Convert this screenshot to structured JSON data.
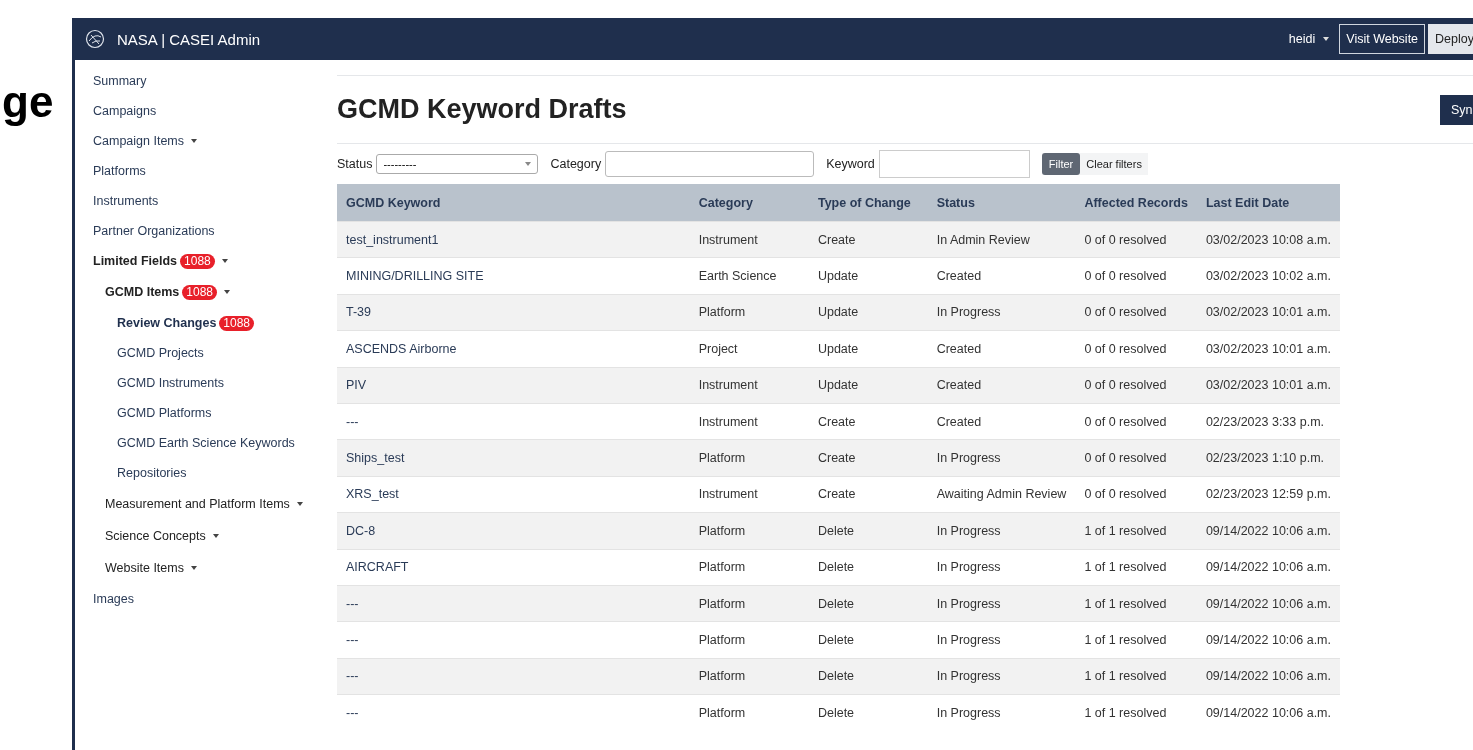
{
  "side_heading": "ge",
  "navbar": {
    "brand": "NASA | CASEI Admin",
    "user": "heidi",
    "buttons": [
      {
        "label": "Visit Website",
        "kind": "outline"
      },
      {
        "label": "Deploy",
        "kind": "light"
      }
    ]
  },
  "sidebar": {
    "items": [
      {
        "label": "Summary",
        "has_menu": false,
        "expanded": false,
        "selected": false
      },
      {
        "label": "Campaigns",
        "has_menu": false,
        "expanded": false,
        "selected": false
      },
      {
        "label": "Campaign Items",
        "has_menu": true,
        "expanded": false,
        "selected": false
      },
      {
        "label": "Platforms",
        "has_menu": false,
        "expanded": false,
        "selected": false
      },
      {
        "label": "Instruments",
        "has_menu": false,
        "expanded": false,
        "selected": false
      },
      {
        "label": "Partner Organizations",
        "has_menu": false,
        "expanded": false,
        "selected": false
      },
      {
        "label": "Limited Fields",
        "badge": "1088",
        "has_menu": true,
        "expanded": true,
        "selected": false,
        "children": [
          {
            "label": "GCMD Items",
            "badge": "1088",
            "has_menu": true,
            "expanded": true,
            "selected": false,
            "children": [
              {
                "label": "Review Changes",
                "badge": "1088",
                "has_menu": false,
                "expanded": false,
                "selected": true
              },
              {
                "label": "GCMD Projects",
                "has_menu": false,
                "expanded": false,
                "selected": false
              },
              {
                "label": "GCMD Instruments",
                "has_menu": false,
                "expanded": false,
                "selected": false
              },
              {
                "label": "GCMD Platforms",
                "has_menu": false,
                "expanded": false,
                "selected": false
              },
              {
                "label": "GCMD Earth Science Keywords",
                "has_menu": false,
                "expanded": false,
                "selected": false
              },
              {
                "label": "Repositories",
                "has_menu": false,
                "expanded": false,
                "selected": false
              }
            ]
          },
          {
            "label": "Measurement and Platform Items",
            "has_menu": true,
            "expanded": false,
            "selected": false
          },
          {
            "label": "Science Concepts",
            "has_menu": true,
            "expanded": false,
            "selected": false
          },
          {
            "label": "Website Items",
            "has_menu": true,
            "expanded": false,
            "selected": false
          }
        ]
      },
      {
        "label": "Images",
        "has_menu": false,
        "expanded": false,
        "selected": false
      }
    ]
  },
  "page_title": "GCMD Keyword Drafts",
  "sync_button": "Syn",
  "filters": {
    "status_label": "Status",
    "status_value": "---------",
    "category_label": "Category",
    "keyword_label": "Keyword",
    "filter_button": "Filter",
    "clear_button": "Clear filters"
  },
  "table": {
    "columns": [
      "GCMD Keyword",
      "Category",
      "Type of Change",
      "Status",
      "Affected Records",
      "Last Edit Date"
    ],
    "rows": [
      [
        "test_instrument1",
        "Instrument",
        "Create",
        "In Admin Review",
        "0 of 0 resolved",
        "03/02/2023 10:08 a.m."
      ],
      [
        "MINING/DRILLING SITE",
        "Earth Science",
        "Update",
        "Created",
        "0 of 0 resolved",
        "03/02/2023 10:02 a.m."
      ],
      [
        "T-39",
        "Platform",
        "Update",
        "In Progress",
        "0 of 0 resolved",
        "03/02/2023 10:01 a.m."
      ],
      [
        "ASCENDS Airborne",
        "Project",
        "Update",
        "Created",
        "0 of 0 resolved",
        "03/02/2023 10:01 a.m."
      ],
      [
        "PIV",
        "Instrument",
        "Update",
        "Created",
        "0 of 0 resolved",
        "03/02/2023 10:01 a.m."
      ],
      [
        "---",
        "Instrument",
        "Create",
        "Created",
        "0 of 0 resolved",
        "02/23/2023 3:33 p.m."
      ],
      [
        "Ships_test",
        "Platform",
        "Create",
        "In Progress",
        "0 of 0 resolved",
        "02/23/2023 1:10 p.m."
      ],
      [
        "XRS_test",
        "Instrument",
        "Create",
        "Awaiting Admin Review",
        "0 of 0 resolved",
        "02/23/2023 12:59 p.m."
      ],
      [
        "DC-8",
        "Platform",
        "Delete",
        "In Progress",
        "1 of 1 resolved",
        "09/14/2022 10:06 a.m."
      ],
      [
        "AIRCRAFT",
        "Platform",
        "Delete",
        "In Progress",
        "1 of 1 resolved",
        "09/14/2022 10:06 a.m."
      ],
      [
        "---",
        "Platform",
        "Delete",
        "In Progress",
        "1 of 1 resolved",
        "09/14/2022 10:06 a.m."
      ],
      [
        "---",
        "Platform",
        "Delete",
        "In Progress",
        "1 of 1 resolved",
        "09/14/2022 10:06 a.m."
      ],
      [
        "---",
        "Platform",
        "Delete",
        "In Progress",
        "1 of 1 resolved",
        "09/14/2022 10:06 a.m."
      ],
      [
        "---",
        "Platform",
        "Delete",
        "In Progress",
        "1 of 1 resolved",
        "09/14/2022 10:06 a.m."
      ]
    ]
  }
}
